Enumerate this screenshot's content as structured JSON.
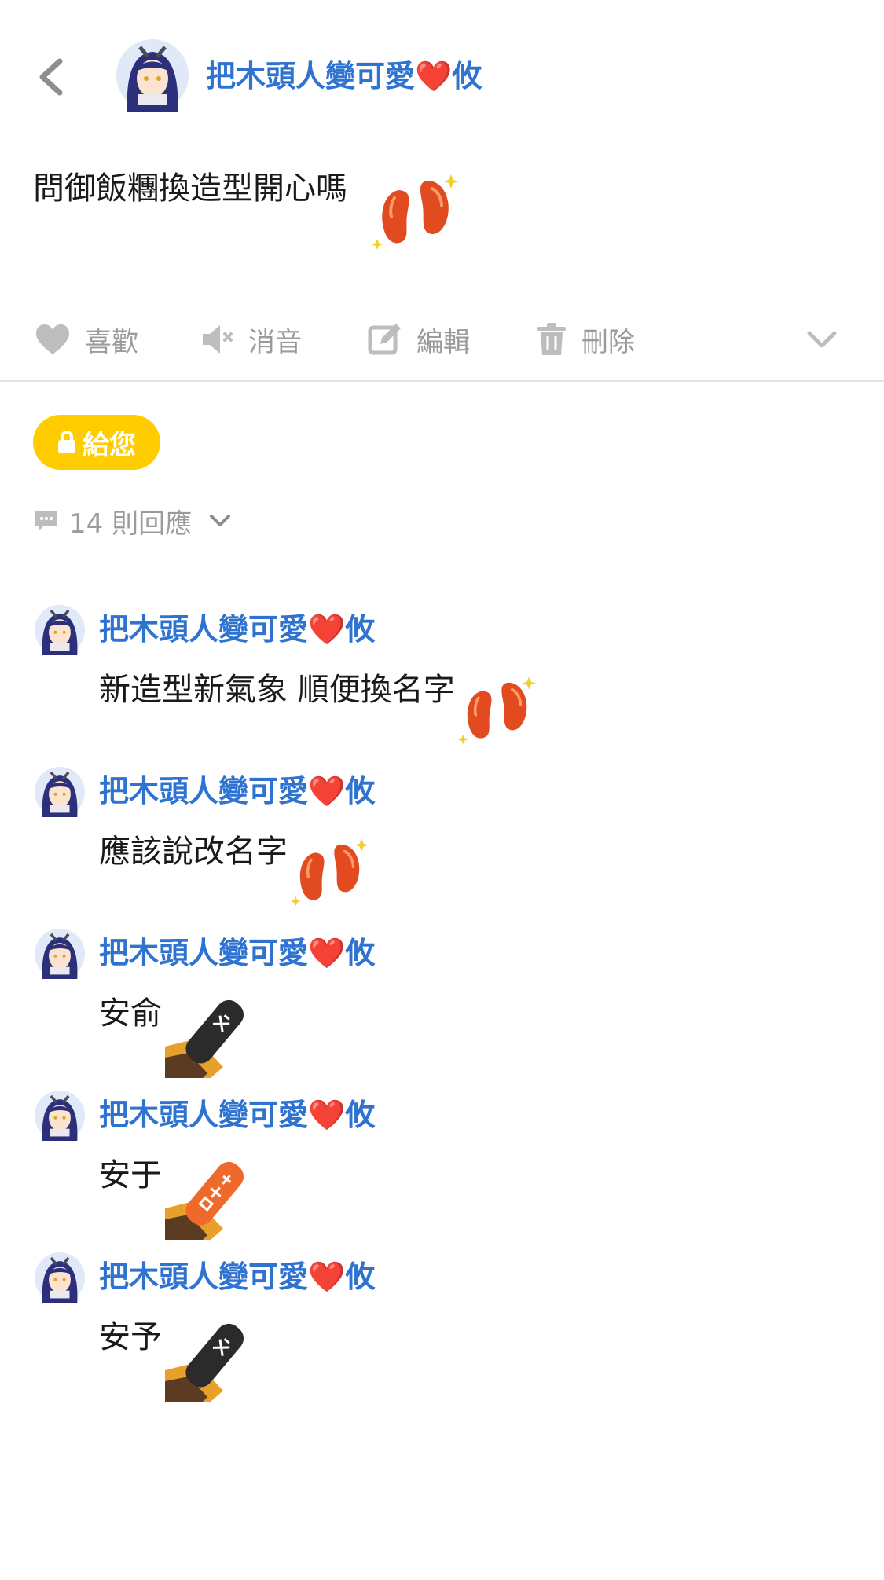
{
  "header": {
    "back_icon": "chevron-left-icon",
    "avatar_icon": "anime-avatar-icon",
    "username": "把木頭人變可愛❤️攸"
  },
  "post": {
    "text": "問御飯糰換造型開心嗎",
    "sticker": "orange-beans-sticker"
  },
  "actions": [
    {
      "icon": "heart-icon",
      "label": "喜歡"
    },
    {
      "icon": "mute-speaker-icon",
      "label": "消音"
    },
    {
      "icon": "edit-icon",
      "label": "編輯"
    },
    {
      "icon": "trash-icon",
      "label": "刪除"
    },
    {
      "icon": "chevron-down-icon"
    }
  ],
  "badge": {
    "icon": "lock-icon",
    "label": "給您",
    "color": "#ffcc00"
  },
  "replies": {
    "icon": "speech-bubble-icon",
    "label": "14 則回應"
  },
  "comments": [
    {
      "username": "把木頭人變可愛❤️攸",
      "text": "新造型新氣象 順便換名字",
      "sticker": "orange-beans-sticker"
    },
    {
      "username": "把木頭人變可愛❤️攸",
      "text": "應該說改名字",
      "sticker": "orange-beans-sticker"
    },
    {
      "username": "把木頭人變可愛❤️攸",
      "text": "安俞",
      "sticker": "fortune-stick-black-sticker"
    },
    {
      "username": "把木頭人變可愛❤️攸",
      "text": "安于",
      "sticker": "fortune-stick-orange-sticker"
    },
    {
      "username": "把木頭人變可愛❤️攸",
      "text": "安予",
      "sticker": "fortune-stick-black-sticker"
    }
  ],
  "colors": {
    "link_blue": "#2f73d1",
    "muted_gray": "#9b9b9b",
    "sticker_orange": "#e24a1f"
  }
}
